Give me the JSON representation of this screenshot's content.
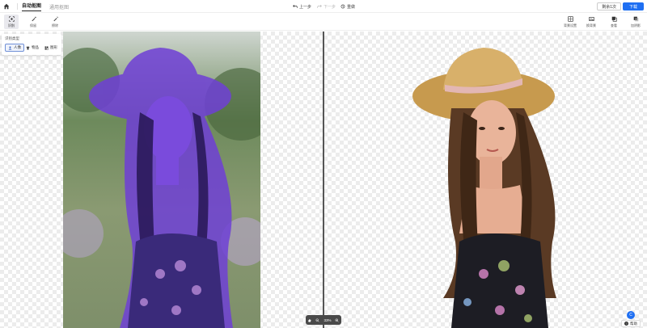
{
  "header": {
    "tabs": [
      {
        "label": "自动抠图"
      },
      {
        "label": "通用抠图"
      }
    ],
    "undo_label": "上一步",
    "redo_label": "下一步",
    "reset_label": "重做",
    "remaining_label": "剩余1次",
    "download_label": "下载"
  },
  "tools_left": [
    {
      "label": "识别",
      "icon": "scan-icon"
    },
    {
      "label": "保留",
      "icon": "brush-keep-icon"
    },
    {
      "label": "擦除",
      "icon": "brush-erase-icon"
    }
  ],
  "tools_right": [
    {
      "label": "背景设置",
      "icon": "background-icon"
    },
    {
      "label": "换背景",
      "icon": "replace-bg-icon"
    },
    {
      "label": "查看",
      "icon": "view-icon"
    },
    {
      "label": "加阴影",
      "icon": "shadow-icon"
    }
  ],
  "recognition": {
    "title": "识别类型",
    "options": [
      {
        "label": "人像"
      },
      {
        "label": "物品"
      },
      {
        "label": "图形"
      }
    ]
  },
  "zoom": {
    "value": "33%"
  },
  "help": {
    "avatar": "C",
    "label": "帮助"
  },
  "colors": {
    "accent": "#1f6ff2",
    "mask": "#6f3fd6"
  }
}
